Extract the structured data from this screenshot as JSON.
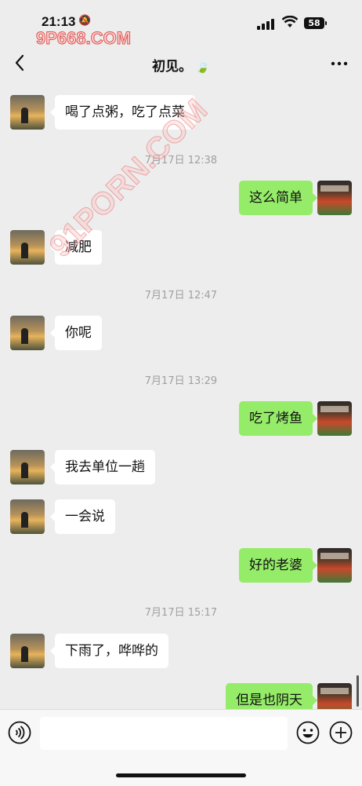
{
  "status_bar": {
    "time": "21:13",
    "battery": "58",
    "watermark": "9P668.COM"
  },
  "nav": {
    "title": "初见。",
    "title_emoji": "🍃"
  },
  "watermark_diag": "91PORN.COM",
  "messages": [
    {
      "sender": "other",
      "text": "喝了点粥，吃了点菜"
    },
    {
      "stamp": "7月17日 12:38"
    },
    {
      "sender": "self",
      "text": "这么简单"
    },
    {
      "sender": "other",
      "text": "减肥"
    },
    {
      "stamp": "7月17日 12:47"
    },
    {
      "sender": "other",
      "text": "你呢"
    },
    {
      "stamp": "7月17日 13:29"
    },
    {
      "sender": "self",
      "text": "吃了烤鱼"
    },
    {
      "sender": "other",
      "text": "我去单位一趟"
    },
    {
      "sender": "other",
      "text": "一会说"
    },
    {
      "sender": "self",
      "text": "好的老婆"
    },
    {
      "stamp": "7月17日 15:17"
    },
    {
      "sender": "other",
      "text": "下雨了，哗哗的"
    },
    {
      "sender": "self",
      "text": "但是也阴天"
    }
  ],
  "input": {
    "placeholder": ""
  },
  "icons": {
    "back": "chevron-left-icon",
    "more": "more-icon",
    "voice": "voice-icon",
    "emoji": "emoji-icon",
    "plus": "plus-icon"
  },
  "colors": {
    "self_bubble": "#95ec69",
    "other_bubble": "#ffffff",
    "background": "#ededed"
  }
}
